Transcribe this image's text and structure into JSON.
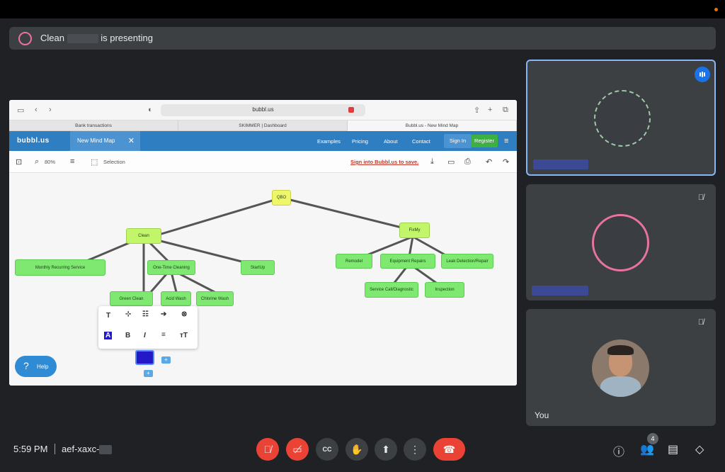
{
  "banner": {
    "presenter_name": "Clean",
    "presenting_suffix": "is presenting"
  },
  "browser": {
    "url": "bubbl.us",
    "tabs": [
      "Bank transactions",
      "SKIMMER | Dashboard",
      "Bubbl.us - New Mind Map"
    ]
  },
  "bubbl": {
    "logo": "bubbl.us",
    "doc_tab": "New Mind Map",
    "nav": [
      "Examples",
      "Pricing",
      "About",
      "Contact"
    ],
    "sign_in": "Sign In",
    "register": "Register",
    "zoom": "80%",
    "selection": "Selection",
    "signin_save": "Sign into Bubbl.us to save."
  },
  "mindmap": {
    "root": "QBO",
    "clean": "Clean",
    "fixmy": "FixMy",
    "monthly": "Monthly Recurring Service",
    "one_time": "One-Time Cleaning",
    "startup": "StartUp",
    "green_clean": "Green     Clean",
    "acid_wash": "Acid Wash",
    "chlorine_wash": "Chlorine Wash",
    "remodel": "Remodel",
    "equipment": "Equipment Repairs",
    "leak": "Leak Detection/Repair",
    "service_call": "Service Call/Diagnostic",
    "inspection": "Inspection"
  },
  "help_label": "Help",
  "self_label": "You",
  "people_count": "4",
  "clock": "5:59 PM",
  "meeting_code": "aef-xaxc-",
  "colors": {
    "accent": "#8ab4f8",
    "danger": "#ea4335",
    "node_green": "#7ee870",
    "bubbl_blue": "#2f7ec2"
  }
}
